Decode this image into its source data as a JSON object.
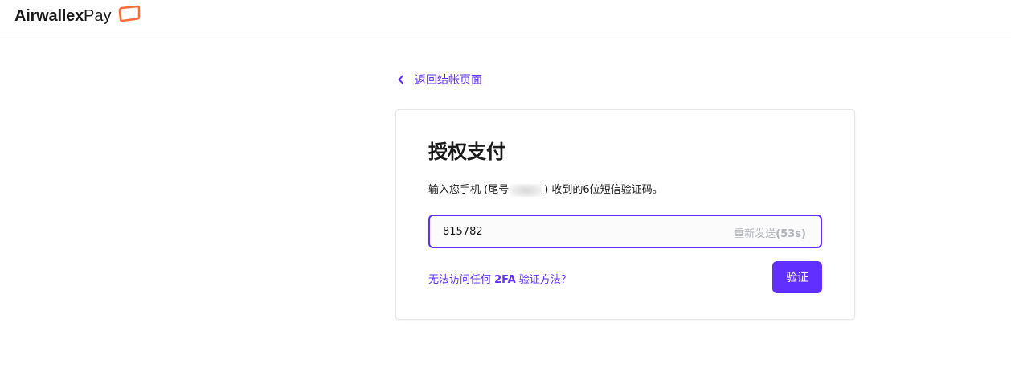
{
  "header": {
    "brand_name": "Airwallex",
    "brand_suffix": "Pay",
    "logo_icon": "airwallex-logo-icon",
    "accent_color": "#612fff",
    "logo_color": "#ff6b35"
  },
  "nav": {
    "back_label": "返回结帐页面",
    "back_icon": "chevron-left-icon"
  },
  "card": {
    "title": "授权支付",
    "desc_prefix": "输入您手机 (尾号",
    "desc_suffix": ") 收到的6位短信验证码。",
    "code_value": "815782",
    "resend_label": "重新发送",
    "resend_count": "(53s)",
    "no_2fa_prefix": "无法访问任何 ",
    "no_2fa_bold": "2FA",
    "no_2fa_suffix": " 验证方法？",
    "verify_label": "验证"
  }
}
